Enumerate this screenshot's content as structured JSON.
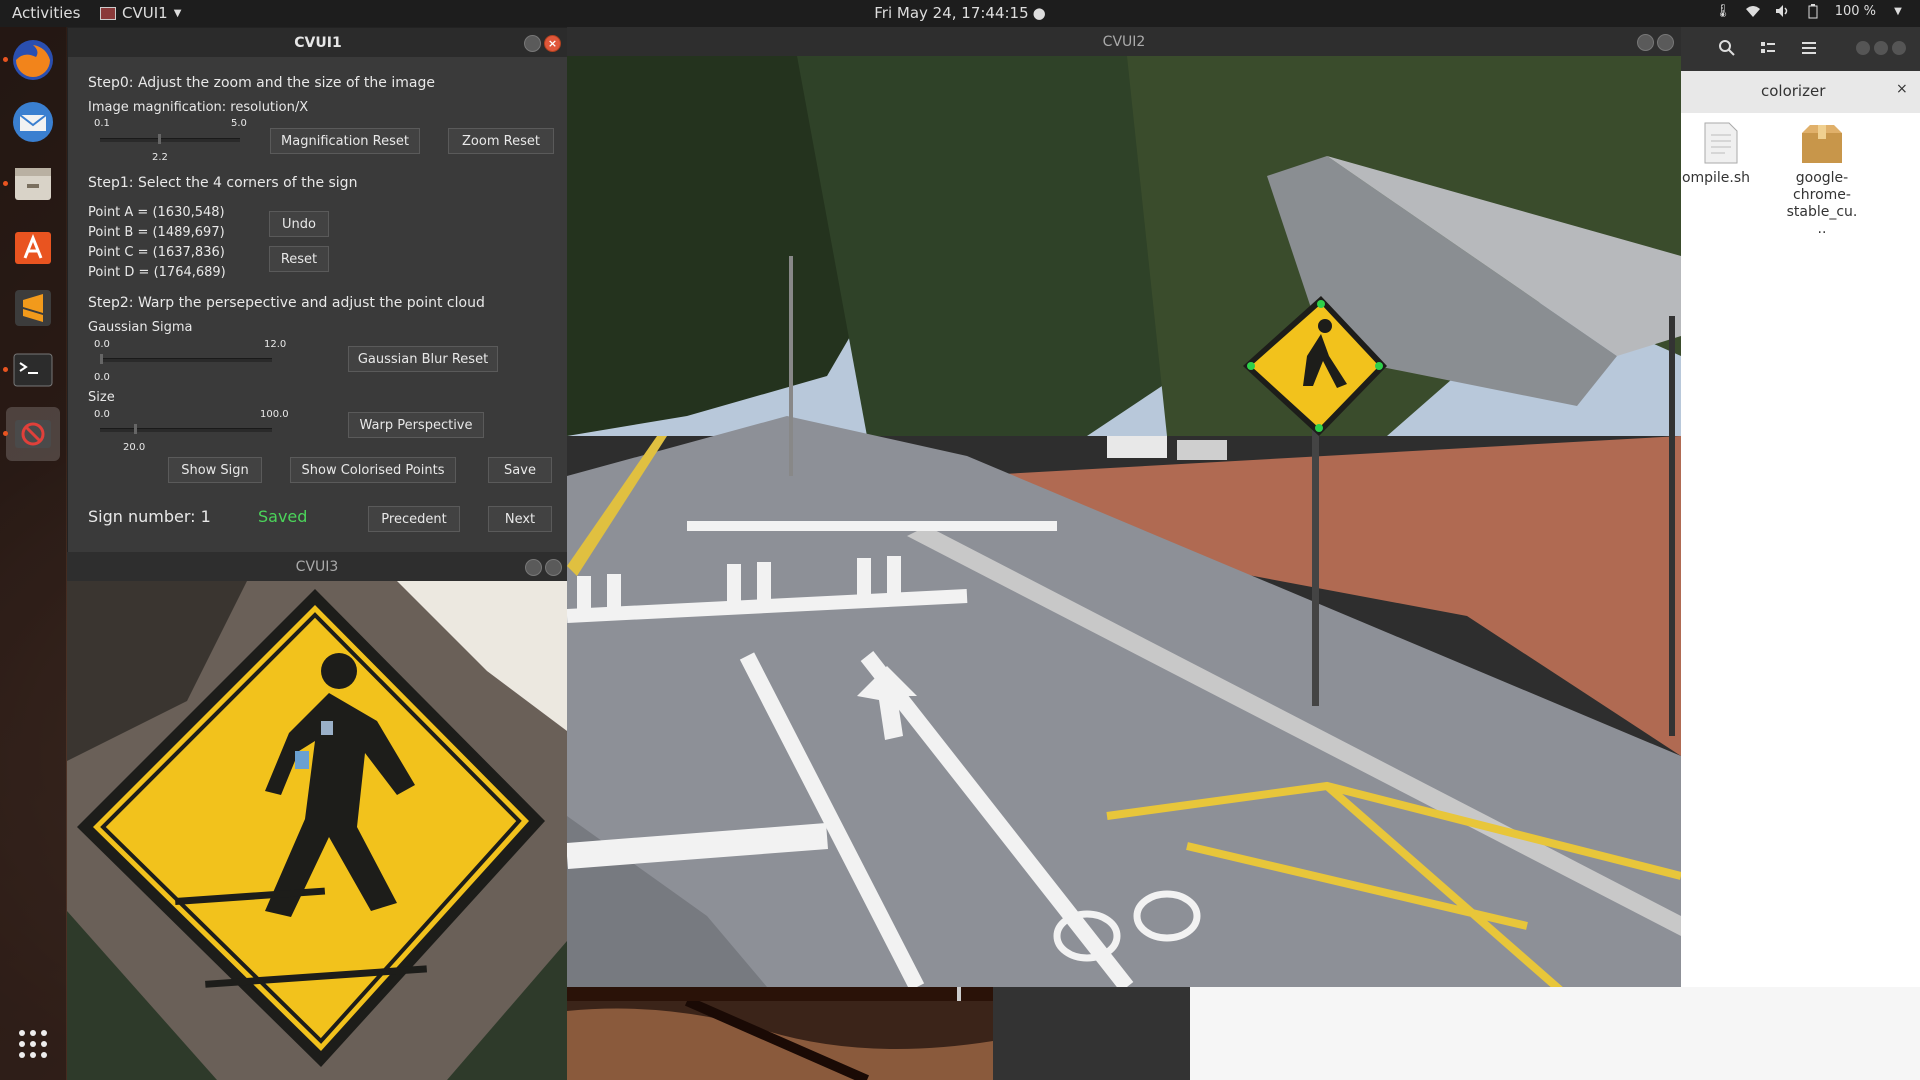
{
  "topbar": {
    "activities": "Activities",
    "app_menu": "CVUI1",
    "clock": "Fri May 24, 17:44:15",
    "battery": "100 %"
  },
  "dock": {
    "items": [
      "firefox",
      "thunderbird",
      "files",
      "software",
      "sublime-text",
      "terminal",
      "cvui-app",
      "show-apps"
    ]
  },
  "cvui1": {
    "title": "CVUI1",
    "step0": "Step0: Adjust the zoom and the size of the image",
    "magnification_label": "Image magnification: resolution/X",
    "mag_min": "0.1",
    "mag_max": "5.0",
    "mag_value": "2.2",
    "magnification_reset": "Magnification Reset",
    "zoom_reset": "Zoom Reset",
    "step1": "Step1: Select the 4 corners of the sign",
    "points": [
      "Point A = (1630,548)",
      "Point B = (1489,697)",
      "Point C = (1637,836)",
      "Point D = (1764,689)"
    ],
    "undo": "Undo",
    "reset": "Reset",
    "step2": "Step2: Warp the persepective and adjust the point cloud",
    "gaussian_label": "Gaussian Sigma",
    "gauss_min": "0.0",
    "gauss_max": "12.0",
    "gauss_value": "0.0",
    "gaussian_reset": "Gaussian Blur Reset",
    "size_label": "Size",
    "size_min": "0.0",
    "size_max": "100.0",
    "size_value": "20.0",
    "warp_perspective": "Warp Perspective",
    "show_sign": "Show Sign",
    "show_colorised": "Show Colorised Points",
    "save": "Save",
    "sign_number": "Sign number:  1",
    "saved": "Saved",
    "precedent": "Precedent",
    "next": "Next"
  },
  "cvui2": {
    "title": "CVUI2"
  },
  "cvui3": {
    "title": "CVUI3"
  },
  "files": {
    "tab_title": "colorizer",
    "items": [
      {
        "name": "ompile.sh"
      },
      {
        "name": "google-chrome-stable_cu..."
      }
    ]
  },
  "colors": {
    "saved_green": "#4bd45a",
    "accent_orange": "#e95420",
    "sign_yellow": "#f2c21c"
  }
}
